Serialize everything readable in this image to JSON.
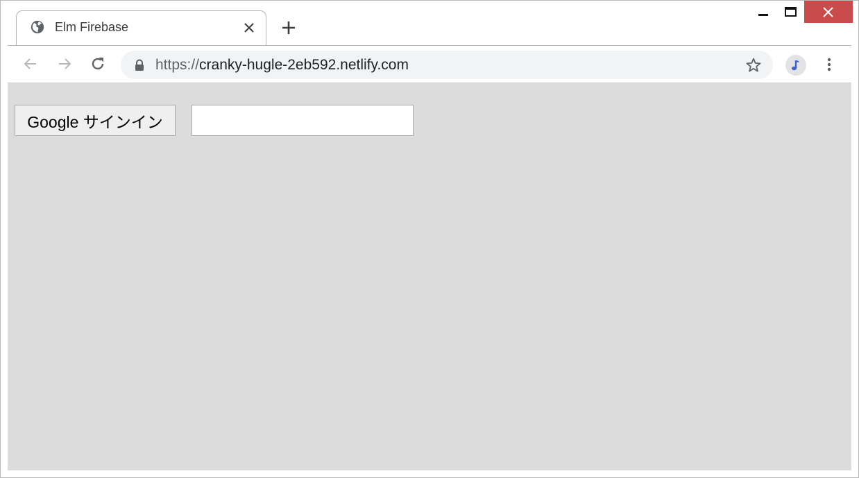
{
  "browser": {
    "tab": {
      "title": "Elm Firebase",
      "icon": "globe-icon"
    },
    "new_tab_icon": "plus-icon",
    "window_controls": [
      "minimize-icon",
      "maximize-icon",
      "close-icon"
    ],
    "address_bar": {
      "scheme": "https://",
      "host": "cranky-hugle-2eb592.netlify.com",
      "secure_icon": "lock-icon"
    },
    "toolbar_icons": [
      "back-arrow-icon",
      "forward-arrow-icon",
      "reload-icon",
      "star-icon",
      "profile-avatar-icon",
      "kebab-menu-icon"
    ]
  },
  "page": {
    "signin_button_label": "Google サインイン",
    "text_input_value": "",
    "background_color": "#dcdcdc"
  },
  "colors": {
    "window_close": "#c94b4b",
    "profile_note": "#3a5fcd"
  }
}
